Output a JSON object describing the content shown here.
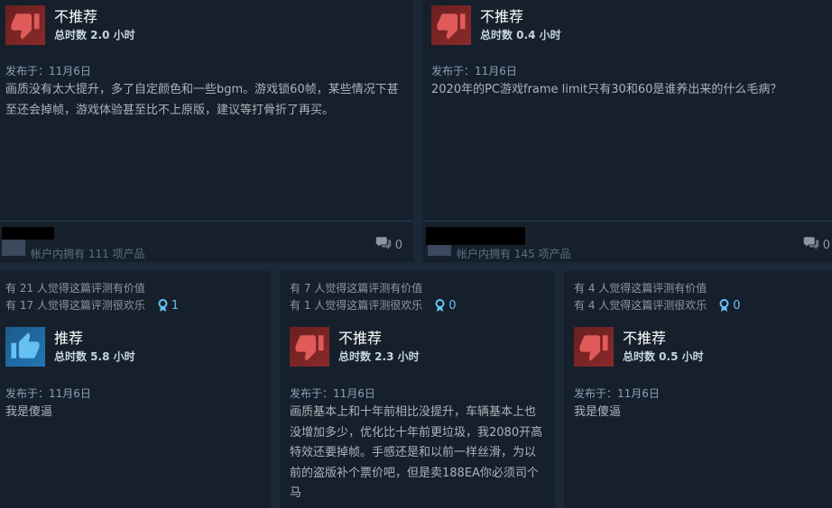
{
  "reviews": [
    {
      "verdict": "不推荐",
      "hours": "总时数 2.0 小时",
      "posted": "发布于：11月6日",
      "body": "画质没有太大提升，多了自定颜色和一些bgm。游戏锁60帧，某些情况下甚至还会掉帧，游戏体验甚至比不上原版，建议等打骨折了再买。",
      "owned": "帐户内拥有 111 项产品",
      "comments": "0"
    },
    {
      "verdict": "不推荐",
      "hours": "总时数 0.4 小时",
      "posted": "发布于：11月6日",
      "body": "2020年的PC游戏frame limit只有30和60是谁养出来的什么毛病？",
      "owned": "帐户内拥有 145 项产品",
      "comments": "0"
    },
    {
      "helpful": "有 21 人觉得这篇评测有价值",
      "funny": "有 17 人觉得这篇评测很欢乐",
      "awards": "1",
      "verdict": "推荐",
      "hours": "总时数 5.8 小时",
      "posted": "发布于：11月6日",
      "body": "我是傻逼"
    },
    {
      "helpful": "有 7 人觉得这篇评测有价值",
      "funny": "有 1 人觉得这篇评测很欢乐",
      "awards": "0",
      "verdict": "不推荐",
      "hours": "总时数 2.3 小时",
      "posted": "发布于：11月6日",
      "body": "画质基本上和十年前相比没提升，车辆基本上也没增加多少，优化比十年前更垃圾，我2080开高特效还要掉帧。手感还是和以前一样丝滑，为以前的盗版补个票价吧，但是卖188EA你必须司个马"
    },
    {
      "helpful": "有 4 人觉得这篇评测有价值",
      "funny": "有 4 人觉得这篇评测很欢乐",
      "awards": "0",
      "verdict": "不推荐",
      "hours": "总时数 0.5 小时",
      "posted": "发布于：11月6日",
      "body": "我是傻逼"
    }
  ],
  "icons": {
    "thumbs_down": "thumbs-down-icon",
    "thumbs_up": "thumbs-up-icon",
    "award": "award-ribbon-icon",
    "comment": "comment-bubble-icon"
  },
  "colors": {
    "background": "#1b2838",
    "card": "#16202d",
    "award_blue": "#66c0f4",
    "thumb_down_red": "#e05a5a",
    "thumb_up_blue": "#66c0f4"
  }
}
